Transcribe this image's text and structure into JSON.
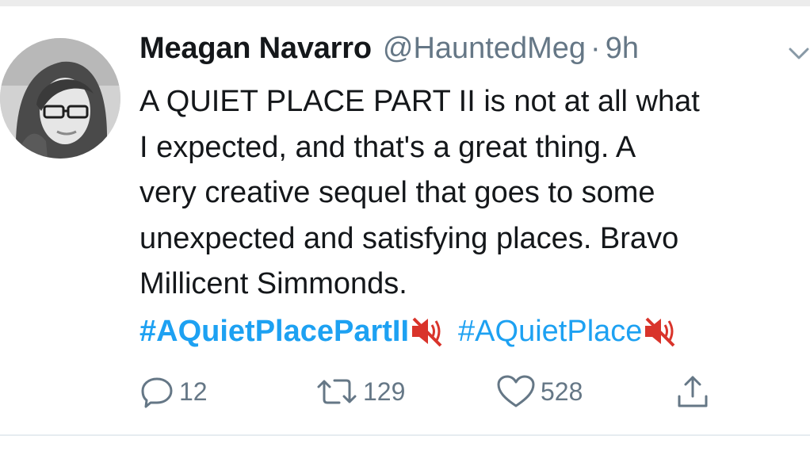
{
  "tweet": {
    "display_name": "Meagan Navarro",
    "handle": "@HauntedMeg",
    "separator": "·",
    "time": "9h",
    "text_lines": [
      "A QUIET PLACE PART II is not at all what",
      "I expected, and that's a great thing. A",
      "very creative sequel that goes to some",
      "unexpected and satisfying places. Bravo",
      "Millicent Simmonds."
    ],
    "hashtags": [
      "#AQuietPlacePartII",
      "#AQuietPlace"
    ],
    "hashtag_emoji": "muted-speaker-icon",
    "actions": {
      "reply_count": "12",
      "retweet_count": "129",
      "like_count": "528"
    }
  },
  "colors": {
    "link": "#1da1f2",
    "text": "#14171a",
    "secondary": "#657786",
    "mute_emoji": "#d9342b"
  }
}
